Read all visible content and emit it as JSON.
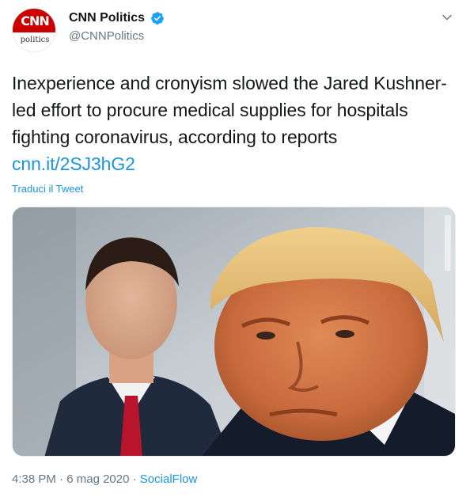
{
  "account": {
    "avatar_top": "CNN",
    "avatar_bottom": "politics",
    "display_name": "CNN Politics",
    "handle": "@CNNPolitics",
    "verified": true,
    "verified_color": "#1da1f2",
    "brand_color": "#cc0000"
  },
  "menu": {
    "caret_icon": "chevron-down-icon"
  },
  "tweet": {
    "text": "Inexperience and cronyism slowed the Jared Kushner-led effort to procure medical supplies for hospitals fighting coronavirus, according to reports",
    "link": "cnn.it/2SJ3hG2",
    "link_color": "#1b95e0",
    "translate_label": "Traduci il Tweet"
  },
  "photo": {
    "description_icon": "news-photo"
  },
  "meta": {
    "time": "4:38 PM",
    "separator": "·",
    "date": "6 mag 2020",
    "source": "SocialFlow"
  }
}
